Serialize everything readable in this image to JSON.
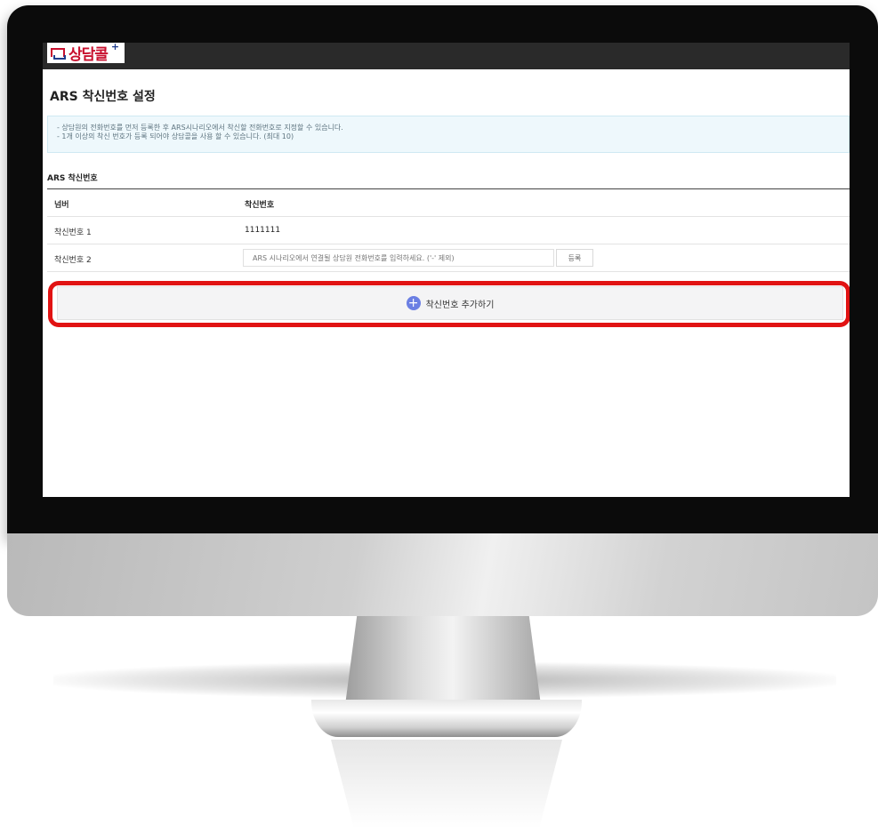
{
  "app": {
    "logo_text": "상담콜",
    "logo_plus": "+"
  },
  "page": {
    "title": "ARS 착신번호 설정"
  },
  "notice": {
    "lines": [
      "- 상담원의 전화번호를 먼저 등록한 후 ARS시나리오에서 착신할 전화번호로 지정할 수 있습니다.",
      "- 1개 이상의 착신 번호가 등록 되어야 상담콜을 사용 할 수 있습니다. (최대 10)"
    ]
  },
  "section": {
    "label": "ARS 착신번호"
  },
  "table": {
    "headers": [
      "넘버",
      "착신번호"
    ],
    "rows": [
      {
        "label": "착신번호 1",
        "value": "1111111"
      },
      {
        "label": "착신번호 2",
        "placeholder": "ARS 시나리오에서 연결될 상담원 전화번호를 입력하세요. ('-' 제외)",
        "button": "등록"
      }
    ]
  },
  "actions": {
    "add_number": "착신번호 추가하기"
  },
  "colors": {
    "highlight": "#e11313",
    "accent": "#6b7fe3",
    "topbar": "#2a2a2a"
  }
}
